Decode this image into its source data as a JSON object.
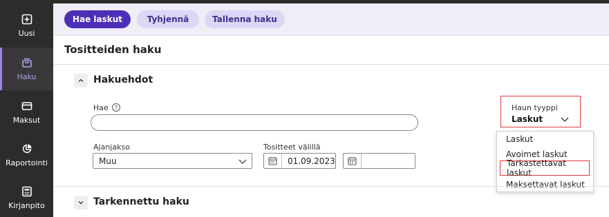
{
  "sidebar": {
    "items": [
      {
        "label": "Uusi",
        "icon": "plus-square-icon"
      },
      {
        "label": "Haku",
        "icon": "inbox-search-icon",
        "active": true
      },
      {
        "label": "Maksut",
        "icon": "card-icon"
      },
      {
        "label": "Raportointi",
        "icon": "pie-chart-icon"
      },
      {
        "label": "Kirjanpito",
        "icon": "calculator-icon"
      }
    ]
  },
  "toolbar": {
    "search_label": "Hae laskut",
    "clear_label": "Tyhjennä",
    "save_label": "Tallenna haku"
  },
  "page": {
    "title": "Tositteiden haku"
  },
  "criteria": {
    "section_title": "Hakuehdot",
    "search_label": "Hae",
    "search_value": "",
    "period_label": "Ajanjakso",
    "period_value": "Muu",
    "range_label": "Tositteet välillä",
    "date_from": "01.09.2023",
    "date_to": ""
  },
  "search_type": {
    "label": "Haun tyyppi",
    "value": "Laskut",
    "options": [
      "Laskut",
      "Avoimet laskut",
      "Tarkastettavat laskut",
      "Maksettavat laskut"
    ],
    "highlighted_option": "Tarkastettavat laskut"
  },
  "advanced": {
    "section_title": "Tarkennettu haku"
  },
  "colors": {
    "accent": "#4b2fb8",
    "sidebar_bg": "#2d2c2b",
    "highlight_border": "#e53935"
  }
}
